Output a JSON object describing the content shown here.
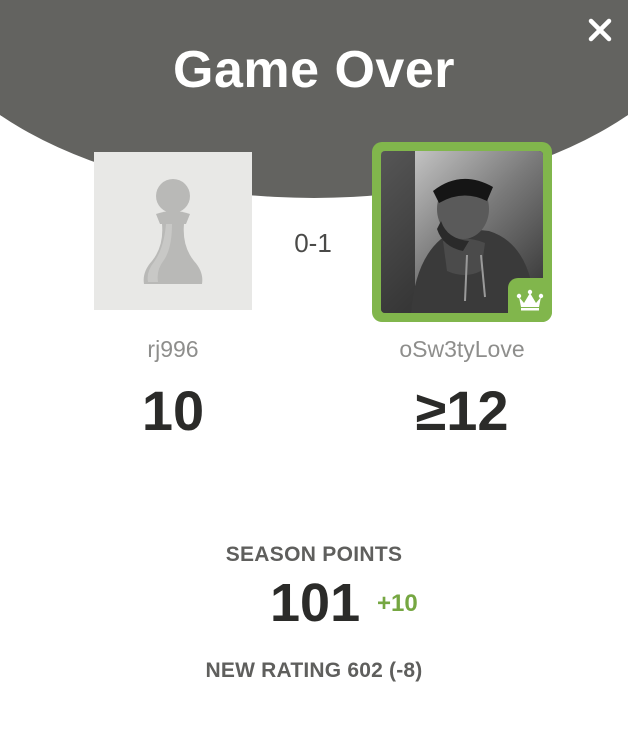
{
  "modal": {
    "title": "Game Over",
    "close_icon": "close-icon"
  },
  "result": {
    "score": "0-1"
  },
  "players": [
    {
      "username": "rj996",
      "rating": "10",
      "avatar_icon": "pawn-icon"
    },
    {
      "username": "oSw3tyLove",
      "rating": "≥12",
      "avatar_icon": "user-photo",
      "badge_icon": "crown-icon"
    }
  ],
  "season": {
    "label": "SEASON POINTS",
    "points": "101",
    "delta": "+10"
  },
  "new_rating": {
    "text": "NEW RATING 602 (-8)"
  },
  "colors": {
    "header": "#636360",
    "winner_border": "#81b64c",
    "positive": "#76a742"
  }
}
